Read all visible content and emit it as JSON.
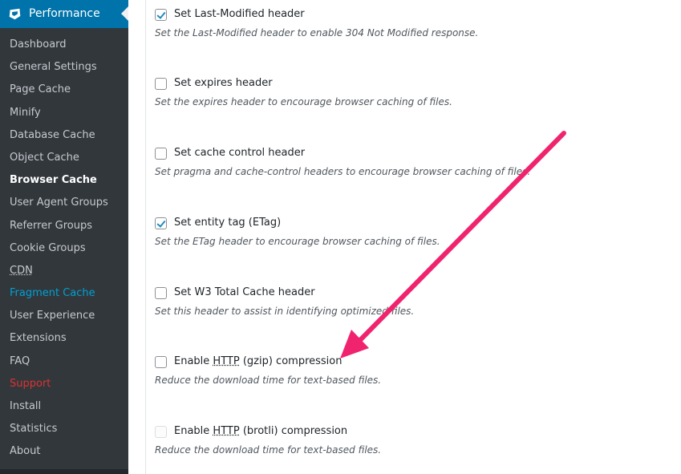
{
  "sidebar": {
    "header": {
      "title": "Performance",
      "icon": "w3tc-logo-icon"
    },
    "items": [
      {
        "label": "Dashboard",
        "color": "#c6cad0"
      },
      {
        "label": "General Settings",
        "color": "#c6cad0"
      },
      {
        "label": "Page Cache",
        "color": "#c6cad0"
      },
      {
        "label": "Minify",
        "color": "#c6cad0"
      },
      {
        "label": "Database Cache",
        "color": "#c6cad0"
      },
      {
        "label": "Object Cache",
        "color": "#c6cad0"
      },
      {
        "label": "Browser Cache",
        "color": "#ffffff",
        "active": true
      },
      {
        "label": "User Agent Groups",
        "color": "#c6cad0"
      },
      {
        "label": "Referrer Groups",
        "color": "#c6cad0"
      },
      {
        "label": "Cookie Groups",
        "color": "#c6cad0"
      },
      {
        "label": "CDN",
        "color": "#c6cad0"
      },
      {
        "label": "Fragment Cache",
        "color": "#00a0d2"
      },
      {
        "label": "User Experience",
        "color": "#c6cad0"
      },
      {
        "label": "Extensions",
        "color": "#c6cad0"
      },
      {
        "label": "FAQ",
        "color": "#c6cad0"
      },
      {
        "label": "Support",
        "color": "#dc3232"
      },
      {
        "label": "Install",
        "color": "#c6cad0"
      },
      {
        "label": "Statistics",
        "color": "#c6cad0"
      },
      {
        "label": "About",
        "color": "#c6cad0"
      }
    ]
  },
  "options": [
    {
      "label": "Set Last-Modified header",
      "checked": true,
      "description": "Set the Last-Modified header to enable 304 Not Modified response."
    },
    {
      "label": "Set expires header",
      "checked": false,
      "description": "Set the expires header to encourage browser caching of files."
    },
    {
      "label": "Set cache control header",
      "checked": false,
      "description": "Set pragma and cache-control headers to encourage browser caching of files."
    },
    {
      "label": "Set entity tag (ETag)",
      "checked": true,
      "description": "Set the ETag header to encourage browser caching of files."
    },
    {
      "label": "Set W3 Total Cache header",
      "checked": false,
      "description": "Set this header to assist in identifying optimized files."
    },
    {
      "label_prefix": "Enable ",
      "label_abbr": "HTTP",
      "label_suffix": " (gzip) compression",
      "checked": false,
      "description": "Reduce the download time for text-based files."
    },
    {
      "label_prefix": "Enable ",
      "label_abbr": "HTTP",
      "label_suffix": " (brotli) compression",
      "checked": false,
      "disabled": true,
      "description": "Reduce the download time for text-based files."
    }
  ],
  "annotation": {
    "arrow_color": "#f0246e",
    "icon": "pointer-arrow-icon"
  }
}
